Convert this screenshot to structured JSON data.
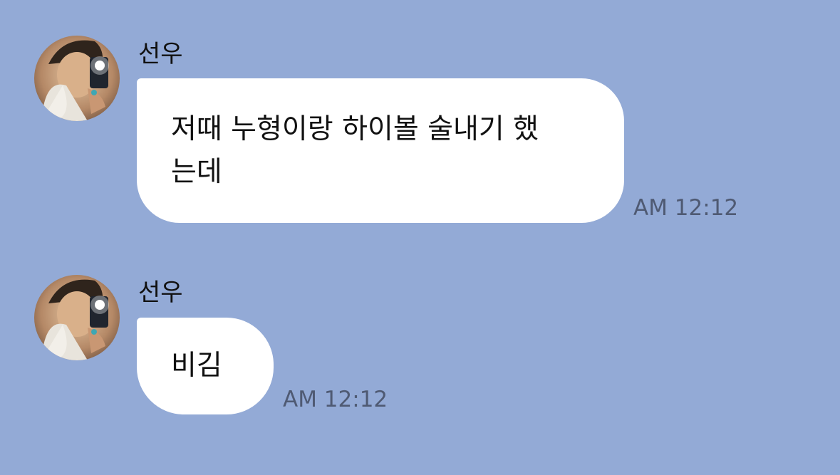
{
  "chat": {
    "background_color": "#93AAD6",
    "messages": [
      {
        "sender": "선우",
        "text_lines": [
          "저때 누형이랑 하이볼 술내기 했",
          "는데"
        ],
        "time": "AM 12:12"
      },
      {
        "sender": "선우",
        "text_lines": [
          "비김"
        ],
        "time": "AM 12:12"
      }
    ]
  }
}
